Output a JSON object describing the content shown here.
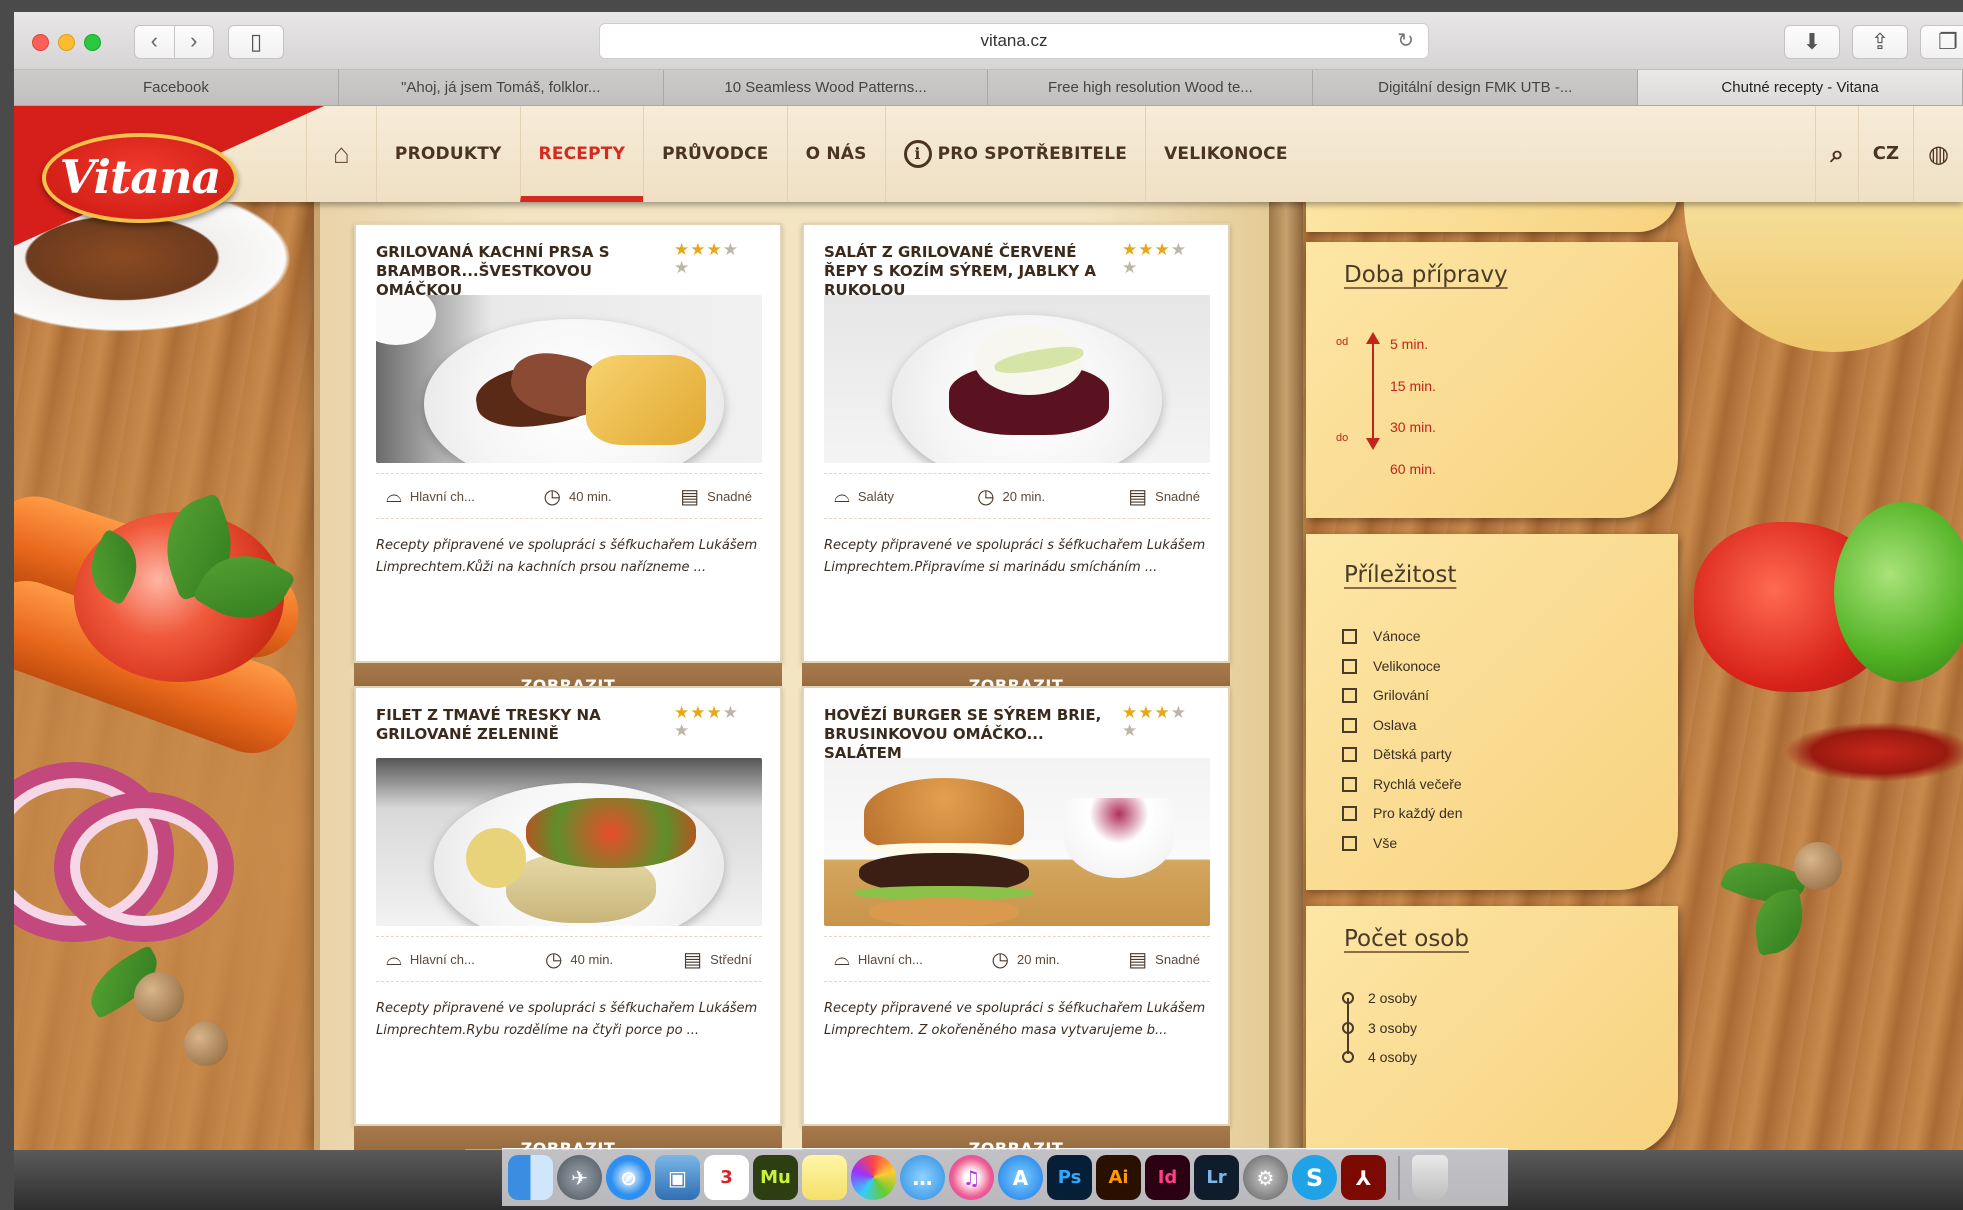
{
  "browser": {
    "url": "vitana.cz",
    "tabs": [
      {
        "label": "Facebook",
        "active": false
      },
      {
        "label": "\"Ahoj, já jsem Tomáš, folklor...",
        "active": false
      },
      {
        "label": "10 Seamless Wood Patterns...",
        "active": false
      },
      {
        "label": "Free high resolution Wood te...",
        "active": false
      },
      {
        "label": "Digitální design FMK UTB -...",
        "active": false
      },
      {
        "label": "Chutné recepty - Vitana",
        "active": true
      }
    ]
  },
  "site": {
    "logo_text": "Vitana",
    "accent_color": "#d52a1f",
    "nav": [
      {
        "label": "PRODUKTY"
      },
      {
        "label": "RECEPTY",
        "active": true
      },
      {
        "label": "PRŮVODCE"
      },
      {
        "label": "O NÁS"
      },
      {
        "label": "PRO SPOTŘEBITELE"
      },
      {
        "label": "VELIKONOCE"
      }
    ],
    "language": "CZ"
  },
  "recipes": [
    {
      "title": "GRILOVANÁ KACHNÍ PRSA S BRAMBOR...ŠVESTKOVOU OMÁČKOU",
      "rating": 3,
      "category": "Hlavní ch...",
      "time": "40 min.",
      "difficulty": "Snadné",
      "description": "Recepty připravené ve spolupráci s šéfkuchařem Lukášem Limprechtem.Kůži na kachních prsou nařízneme ...",
      "button": "ZOBRAZIT"
    },
    {
      "title": "SALÁT Z GRILOVANÉ ČERVENÉ ŘEPY S KOZÍM SÝREM, JABLKY A RUKOLOU",
      "rating": 3,
      "category": "Saláty",
      "time": "20 min.",
      "difficulty": "Snadné",
      "description": "Recepty připravené ve spolupráci s šéfkuchařem Lukášem Limprechtem.Připravíme si marinádu smícháním ...",
      "button": "ZOBRAZIT"
    },
    {
      "title": "FILET Z TMAVÉ TRESKY NA GRILOVANÉ ZELENINĚ",
      "rating": 3,
      "category": "Hlavní ch...",
      "time": "40 min.",
      "difficulty": "Střední",
      "description": "Recepty připravené ve spolupráci s šéfkuchařem Lukášem Limprechtem.Rybu rozdělíme na čtyři porce po ...",
      "button": "ZOBRAZIT"
    },
    {
      "title": "HOVĚZÍ BURGER SE SÝREM BRIE, BRUSINKOVOU OMÁČKO... SALÁTEM",
      "rating": 3,
      "category": "Hlavní ch...",
      "time": "20 min.",
      "difficulty": "Snadné",
      "description": "Recepty připravené ve spolupráci s šéfkuchařem Lukášem Limprechtem. Z okořeněného masa vytvarujeme b...",
      "button": "ZOBRAZIT"
    }
  ],
  "filters": {
    "prep": {
      "title": "Doba přípravy",
      "from_label": "od",
      "to_label": "do",
      "options": [
        "5 min.",
        "15 min.",
        "30 min.",
        "60 min."
      ]
    },
    "occasion": {
      "title": "Příležitost",
      "options": [
        "Vánoce",
        "Velikonoce",
        "Grilování",
        "Oslava",
        "Dětská party",
        "Rychlá večeře",
        "Pro každý den",
        "Vše"
      ]
    },
    "persons": {
      "title": "Počet osob",
      "options": [
        "2 osoby",
        "3 osoby",
        "4 osoby"
      ]
    }
  },
  "dock": {
    "apps": [
      "Finder",
      "Launchpad",
      "Safari",
      "Preview",
      "Calendar",
      "Mu",
      "Notes",
      "Photos",
      "Messages",
      "iTunes",
      "App Store",
      "Ps",
      "Ai",
      "Id",
      "Lr",
      "System Preferences",
      "Skype",
      "Acrobat",
      "Trash"
    ]
  }
}
